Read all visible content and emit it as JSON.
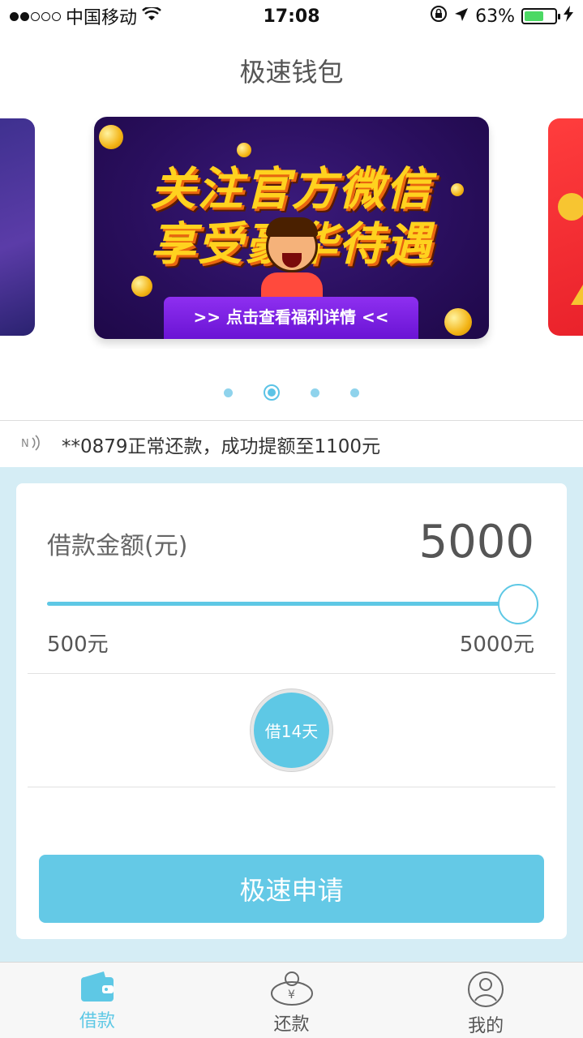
{
  "status_bar": {
    "carrier": "中国移动",
    "time": "17:08",
    "battery_percent": "63%",
    "battery_level": 0.63
  },
  "page_title": "极速钱包",
  "banner": {
    "line1": "关注官方微信",
    "line2": "享受豪华待遇",
    "button": ">> 点击查看福利详情 <<"
  },
  "carousel": {
    "page_count": 4,
    "active_index": 1
  },
  "notice": {
    "text": "**0879正常还款，成功提额至1100元"
  },
  "loan": {
    "amount_label": "借款金额(元)",
    "amount_value": "5000",
    "min_label": "500元",
    "max_label": "5000元",
    "slider_fraction": 1.0,
    "term_label": "借14天",
    "apply_label": "极速申请"
  },
  "tabbar": {
    "items": [
      {
        "label": "借款",
        "icon": "wallet-icon",
        "active": true
      },
      {
        "label": "还款",
        "icon": "yen-coins-icon",
        "active": false
      },
      {
        "label": "我的",
        "icon": "user-icon",
        "active": false
      }
    ]
  },
  "colors": {
    "accent": "#5ec8e5",
    "panel_bg": "#d5edf5",
    "banner_purple": "#2a0f5e"
  }
}
